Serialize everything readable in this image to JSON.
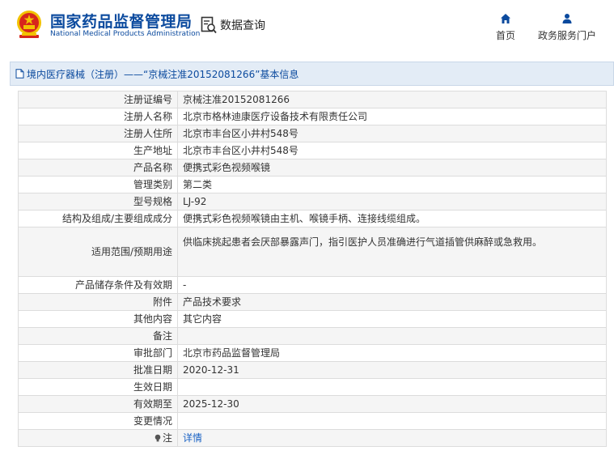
{
  "header": {
    "brand_cn": "国家药品监督管理局",
    "brand_en": "National Medical Products Administration",
    "data_query": "数据查询",
    "nav": {
      "home": "首页",
      "services": "政务服务门户"
    }
  },
  "section": {
    "title": "境内医疗器械（注册）——“京械注准20152081266”基本信息"
  },
  "rows": [
    {
      "label": "注册证编号",
      "value": "京械注准20152081266"
    },
    {
      "label": "注册人名称",
      "value": "北京市格林迪康医疗设备技术有限责任公司"
    },
    {
      "label": "注册人住所",
      "value": "北京市丰台区小井村548号"
    },
    {
      "label": "生产地址",
      "value": "北京市丰台区小井村548号"
    },
    {
      "label": "产品名称",
      "value": "便携式彩色视频喉镜"
    },
    {
      "label": "管理类别",
      "value": "第二类"
    },
    {
      "label": "型号规格",
      "value": "LJ-92"
    },
    {
      "label": "结构及组成/主要组成成分",
      "value": "便携式彩色视频喉镜由主机、喉镜手柄、连接线缆组成。"
    },
    {
      "label": "适用范围/预期用途",
      "value": "供临床挑起患者会厌部暴露声门，指引医护人员准确进行气道插管供麻醉或急救用。"
    },
    {
      "label": "产品储存条件及有效期",
      "value": "-"
    },
    {
      "label": "附件",
      "value": "产品技术要求"
    },
    {
      "label": "其他内容",
      "value": "其它内容"
    },
    {
      "label": "备注",
      "value": ""
    },
    {
      "label": "审批部门",
      "value": "北京市药品监督管理局"
    },
    {
      "label": "批准日期",
      "value": "2020-12-31"
    },
    {
      "label": "生效日期",
      "value": ""
    },
    {
      "label": "有效期至",
      "value": "2025-12-30"
    },
    {
      "label": "变更情况",
      "value": ""
    },
    {
      "label": "注",
      "value": "详情"
    }
  ],
  "colors": {
    "brand_blue": "#0b4a9e",
    "link_blue": "#1a62c4",
    "emblem_red": "#d7261c",
    "emblem_gold": "#f2c200"
  },
  "icons": [
    "national-emblem-icon",
    "data-query-icon",
    "home-icon",
    "user-icon",
    "document-icon",
    "lightbulb-icon"
  ]
}
